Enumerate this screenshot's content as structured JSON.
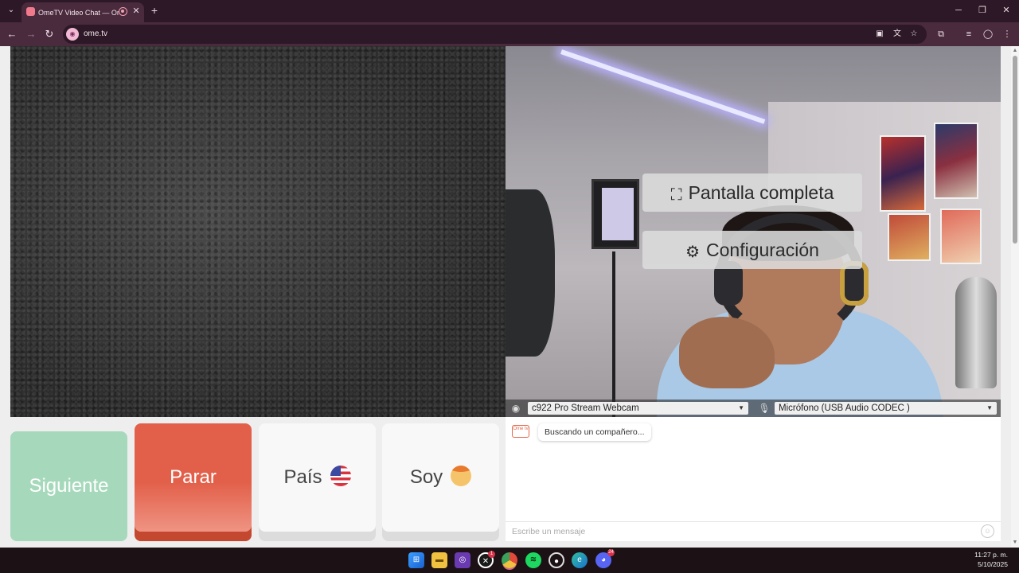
{
  "browser": {
    "tab": {
      "title": "OmeTV Video Chat — Omegle",
      "favicon": "ometv-favicon-icon"
    },
    "new_tab": "+",
    "url": "ome.tv",
    "window_controls": {
      "minimize": "─",
      "restore": "❐",
      "close": "✕"
    }
  },
  "video": {
    "overlay": {
      "fullscreen_label": "Pantalla completa",
      "settings_label": "Configuración"
    },
    "devices": {
      "camera": "c922 Pro Stream Webcam",
      "microphone": "Micrófono (USB Audio CODEC )"
    }
  },
  "controls": {
    "next_label": "Siguiente",
    "stop_label": "Parar",
    "country_label": "País",
    "gender_label": "Soy"
  },
  "chat": {
    "logo_text": "Ome tv",
    "status_message": "Buscando un compañero...",
    "input_placeholder": "Escribe un mensaje"
  },
  "taskbar": {
    "time": "11:27 p. m.",
    "date": "5/10/2025",
    "badges": {
      "xbox": "1",
      "discord": "24"
    }
  },
  "colors": {
    "next_button": "#a6d9bb",
    "stop_button": "#e2604a",
    "browser_frame": "#4a2a3d"
  }
}
